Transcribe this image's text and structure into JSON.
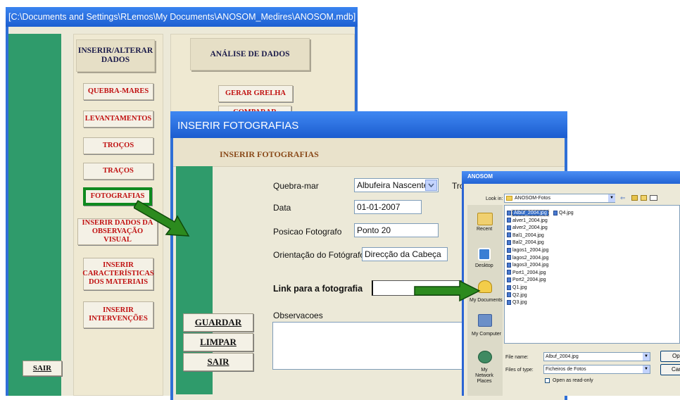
{
  "main_window": {
    "title": "[C:\\Documents and Settings\\RLemos\\My Documents\\ANOSOM_Medires\\ANOSOM.mdb]",
    "section_inserir": "INSERIR/ALTERAR DADOS",
    "section_analise": "ANÁLISE DE DADOS",
    "buttons": {
      "quebra_mares": "QUEBRA-MARES",
      "levantamentos": "LEVANTAMENTOS",
      "trocos": "TROÇOS",
      "tracos": "TRAÇOS",
      "fotografias": "FOTOGRAFIAS",
      "inserir_obs": "INSERIR DADOS DA OBSERVAÇÃO VISUAL",
      "inserir_carac": "INSERIR CARACTERÍSTICAS DOS MATERIAIS",
      "inserir_interv": "INSERIR INTERVENÇÕES",
      "gerar_grelha": "GERAR GRELHA",
      "comparar_grelhas": "COMPARAR GRELHAS",
      "sair": "SAIR"
    }
  },
  "fotografias_window": {
    "title": "INSERIR FOTOGRAFIAS",
    "header": "INSERIR FOTOGRAFIAS",
    "quebra_mar_label": "Quebra-mar",
    "quebra_mar_value": "Albufeira Nascente",
    "troco_label": "Tro",
    "data_label": "Data",
    "data_value": "01-01-2007",
    "posicao_label": "Posicao Fotografo",
    "posicao_value": "Ponto 20",
    "orientacao_label": "Orientação do Fotógrafo",
    "orientacao_value": "Direcção da Cabeça",
    "link_label": "Link para a fotografia",
    "observacoes_label": "Observacoes",
    "guardar": "GUARDAR",
    "limpar": "LIMPAR",
    "sair": "SAIR"
  },
  "file_dialog": {
    "title": "ANOSOM",
    "look_in_label": "Look in:",
    "look_in_value": "ANOSOM-Fotos",
    "places": [
      "Recent",
      "Desktop",
      "My Documents",
      "My Computer",
      "My Network Places"
    ],
    "files_col1": [
      "Albuf_2004.jpg",
      "alver1_2004.jpg",
      "alver2_2004.jpg",
      "Bal1_2004.jpg",
      "Bal2_2004.jpg",
      "lagos1_2004.jpg",
      "lagos2_2004.jpg",
      "lagos3_2004.jpg",
      "Port1_2004.jpg",
      "Port2_2004.jpg",
      "Q1.jpg",
      "Q2.jpg",
      "Q3.jpg"
    ],
    "files_col2": [
      "Q4.jpg"
    ],
    "file_name_label": "File name:",
    "file_name_value": "Albuf_2004.jpg",
    "files_of_type_label": "Files of type:",
    "files_of_type_value": "Ficheiros de Fotos",
    "read_only_label": "Open as read-only",
    "open_button": "Op",
    "cancel_button": "Can"
  },
  "colors": {
    "title_blue": "#1d5fd1",
    "access_green": "#2f9b6b",
    "button_red": "#c01010",
    "arrow_green": "#2c8a1e"
  }
}
